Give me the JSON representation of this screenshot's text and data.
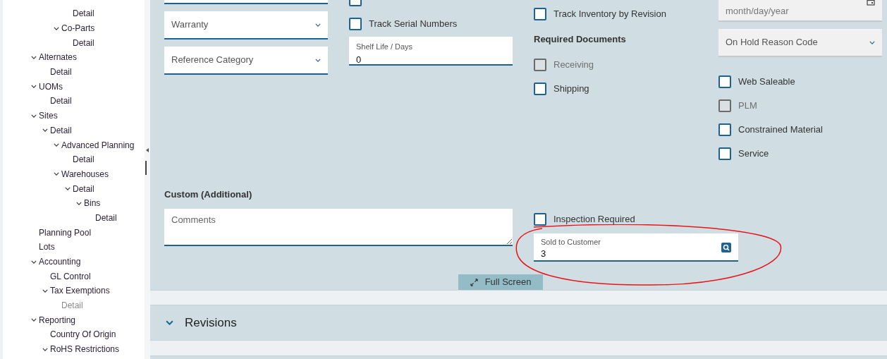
{
  "sidebar": {
    "tree_top": [
      {
        "label": "Detail",
        "disabled": false
      }
    ],
    "tree_continued": [
      {
        "label": "Co-Parts",
        "expanded": true,
        "disabled": false,
        "children": [
          {
            "label": "Detail",
            "disabled": false
          }
        ]
      }
    ],
    "tree": [
      {
        "label": "Alternates",
        "expanded": true,
        "disabled": false,
        "children": [
          {
            "label": "Detail",
            "disabled": false
          }
        ]
      },
      {
        "label": "UOMs",
        "expanded": true,
        "disabled": false,
        "children": [
          {
            "label": "Detail",
            "disabled": false
          }
        ]
      },
      {
        "label": "Sites",
        "expanded": true,
        "disabled": false,
        "children": [
          {
            "label": "Detail",
            "expanded": true,
            "disabled": false,
            "children": [
              {
                "label": "Advanced Planning",
                "expanded": true,
                "disabled": false,
                "children": [
                  {
                    "label": "Detail",
                    "disabled": false
                  }
                ]
              },
              {
                "label": "Warehouses",
                "expanded": true,
                "disabled": false,
                "children": [
                  {
                    "label": "Detail",
                    "expanded": true,
                    "disabled": false,
                    "children": [
                      {
                        "label": "Bins",
                        "expanded": true,
                        "disabled": false,
                        "children": [
                          {
                            "label": "Detail",
                            "disabled": false
                          }
                        ]
                      }
                    ]
                  }
                ]
              }
            ]
          }
        ]
      },
      {
        "label": "Planning Pool",
        "disabled": false
      },
      {
        "label": "Lots",
        "disabled": false
      },
      {
        "label": "Accounting",
        "expanded": true,
        "disabled": false,
        "children": [
          {
            "label": "GL Control",
            "disabled": false
          },
          {
            "label": "Tax Exemptions",
            "expanded": true,
            "disabled": false,
            "children": [
              {
                "label": "Detail",
                "disabled": true
              }
            ]
          }
        ]
      },
      {
        "label": "Reporting",
        "expanded": true,
        "disabled": false,
        "children": [
          {
            "label": "Country Of Origin",
            "disabled": false
          },
          {
            "label": "RoHS Restrictions",
            "expanded": true,
            "disabled": false
          }
        ]
      }
    ]
  },
  "form": {
    "selects": [
      {
        "placeholder": "Warranty"
      },
      {
        "placeholder": "Reference Category"
      }
    ],
    "track_checks": [
      {
        "checked": false,
        "disabled": false
      },
      {
        "label": "Track Serial Numbers",
        "checked": false,
        "disabled": false
      }
    ],
    "shelf_life": {
      "label": "Shelf Life / Days",
      "value": "0"
    },
    "track_revision": {
      "label": "Track Inventory by Revision",
      "checked": false,
      "disabled": false
    },
    "required_documents": {
      "title": "Required Documents",
      "items": [
        {
          "label": "Receiving",
          "checked": false,
          "disabled": true
        },
        {
          "label": "Shipping",
          "checked": false,
          "disabled": false
        }
      ]
    },
    "hold_date": {
      "placeholder": "month/day/year"
    },
    "hold_reason": {
      "placeholder": "On Hold Reason Code"
    },
    "flags": [
      {
        "label": "Web Saleable",
        "checked": false,
        "disabled": false
      },
      {
        "label": "PLM",
        "checked": false,
        "disabled": true
      },
      {
        "label": "Constrained Material",
        "checked": false,
        "disabled": false
      },
      {
        "label": "Service",
        "checked": false,
        "disabled": false
      }
    ],
    "custom": {
      "title": "Custom (Additional)",
      "comments_placeholder": "Comments"
    },
    "inspection": {
      "label": "Inspection Required",
      "checked": false,
      "disabled": false
    },
    "sold_to": {
      "label": "Sold to Customer",
      "value": "3"
    }
  },
  "full_screen": "Full Screen",
  "sections": [
    {
      "title": "Revisions",
      "expanded": false
    }
  ]
}
